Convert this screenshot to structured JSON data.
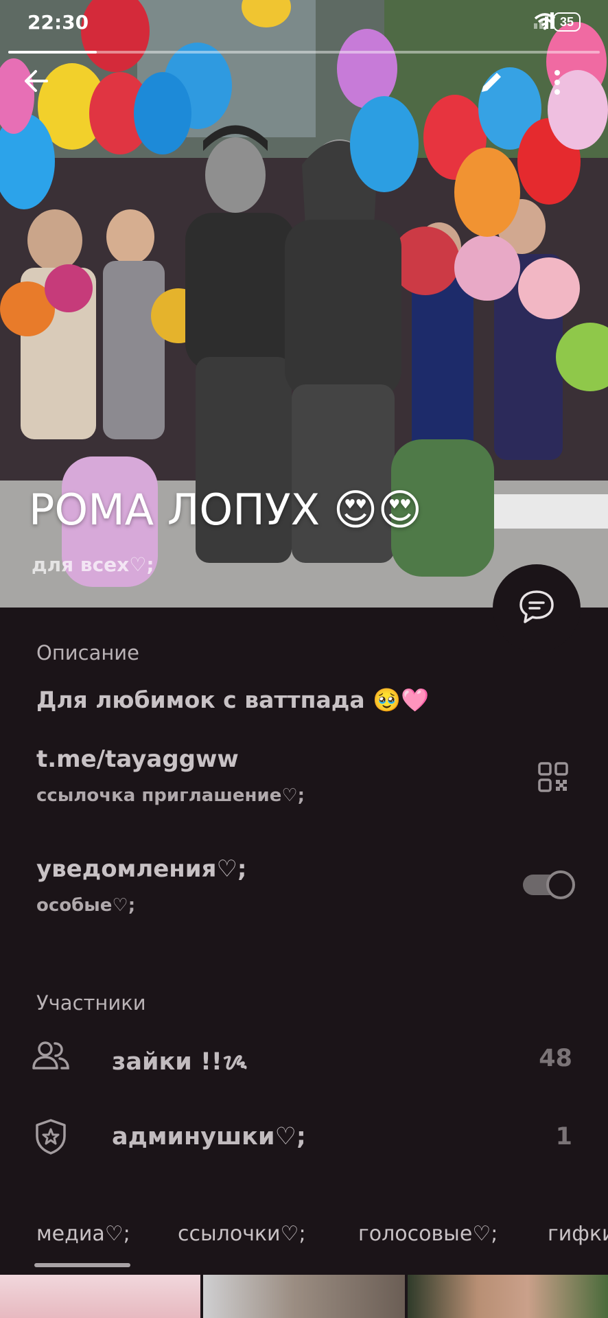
{
  "status_bar": {
    "time": "22:30",
    "battery": "35",
    "icons": [
      "signal-icon",
      "wifi-icon",
      "battery-icon"
    ]
  },
  "story_progress": 0.15,
  "header": {
    "title": "РОМА ЛОПУХ 😍😍",
    "subtitle": "для всех♡;",
    "icons": [
      "back-arrow-icon",
      "pencil-icon",
      "more-vertical-icon",
      "chat-bubble-icon"
    ]
  },
  "description": {
    "label": "Описание",
    "text": "Для любимок с ваттпада 🥹🩷"
  },
  "invite_link": {
    "url": "t.me/tayaggww",
    "caption": "ссылочка приглашение♡;",
    "icon": "qr-code-icon"
  },
  "notifications": {
    "title": "уведомления♡;",
    "caption": "особые♡;",
    "enabled": true
  },
  "members": {
    "label": "Участники",
    "rows": [
      {
        "label": "зайки !!ᝰ",
        "count": "48",
        "icon": "users-icon"
      },
      {
        "label": "админушки♡;",
        "count": "1",
        "icon": "shield-star-icon"
      }
    ]
  },
  "tabs": [
    "медиа♡;",
    "ссылочки♡;",
    "голосовые♡;",
    "гифки"
  ],
  "active_tab": 0,
  "colors": {
    "background": "#1b1418",
    "text": "#c8c2c5",
    "muted": "#7b7477"
  }
}
